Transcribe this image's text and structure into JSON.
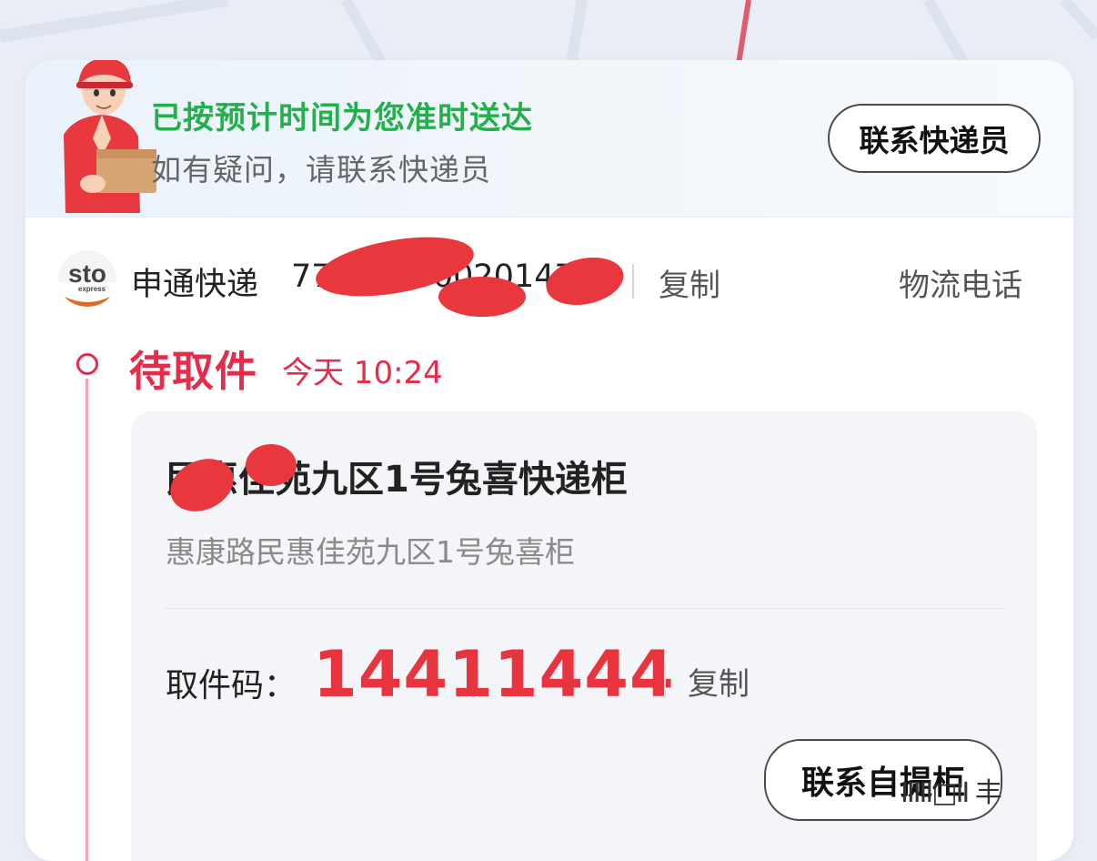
{
  "banner": {
    "title": "已按预计时间为您准时送达",
    "subtitle": "如有疑问，请联系快递员",
    "contact_courier_label": "联系快递员"
  },
  "shipment": {
    "carrier_name": "申通快递",
    "carrier_logo_text": "sto",
    "carrier_logo_sub": "express",
    "tracking_number_visible": "77000000020147",
    "copy_label": "复制",
    "logistics_phone_label": "物流电话"
  },
  "timeline": {
    "status": "待取件",
    "time": "今天 10:24"
  },
  "locker": {
    "name": "民惠佳苑九区1号兔喜快递柜",
    "address": "惠康路民惠佳苑九区1号兔喜柜",
    "pickup_code_label": "取件码：",
    "pickup_code": "14411444",
    "copy_label": "复制",
    "contact_locker_label": "联系自提柜"
  },
  "watermark": "IIIII□II 丰",
  "colors": {
    "accent_red": "#e42d4b",
    "code_red": "#e8343f",
    "success_green": "#22b04b"
  }
}
